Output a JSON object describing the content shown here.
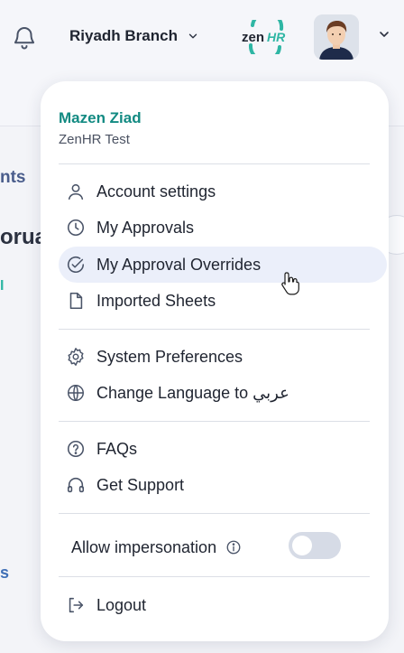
{
  "header": {
    "branch_label": "Riyadh Branch",
    "logo_text_a": "zen",
    "logo_text_b": "HR"
  },
  "background": {
    "frag1": "nts",
    "frag2": "orua",
    "frag3": "I",
    "frag4": "s"
  },
  "user": {
    "name": "Mazen Ziad",
    "company": "ZenHR Test"
  },
  "menu": {
    "account_settings": "Account settings",
    "my_approvals": "My Approvals",
    "my_approval_overrides": "My Approval Overrides",
    "imported_sheets": "Imported Sheets",
    "system_preferences": "System Preferences",
    "change_language": "Change Language to عربي",
    "faqs": "FAQs",
    "get_support": "Get Support",
    "allow_impersonation": "Allow impersonation",
    "logout": "Logout"
  },
  "toggle": {
    "allow_impersonation_on": false
  },
  "colors": {
    "accent": "#128a82",
    "active_bg": "#ebeffa",
    "logo_teal": "#2fb6a4"
  }
}
